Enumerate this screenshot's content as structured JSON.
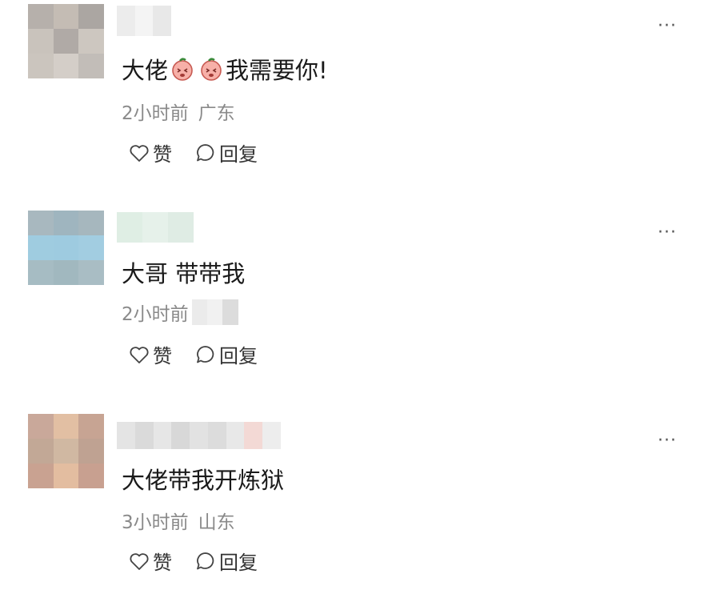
{
  "comments": [
    {
      "text_before": "大佬",
      "text_after": "我需要你!",
      "emoji_count": 2,
      "time": "2小时前",
      "location": "广东",
      "like_label": "赞",
      "reply_label": "回复",
      "avatar_colors": [
        "#b6b0ab",
        "#c4bcb4",
        "#aba6a2",
        "#c9c3bc",
        "#b0aaa6",
        "#cdc7c0",
        "#cbc5be",
        "#d4cec8",
        "#c2bdb8"
      ],
      "username_colors": [
        "#ececec",
        "#f4f4f4",
        "#e8e8e8"
      ]
    },
    {
      "text": "大哥 带带我",
      "time": "2小时前",
      "like_label": "赞",
      "reply_label": "回复",
      "avatar_colors": [
        "#a8b8bf",
        "#9fb5bf",
        "#a6b7be",
        "#9fcce0",
        "#9ecbe0",
        "#a2cde1",
        "#a6bcc3",
        "#a1b8bf",
        "#a9bdc4"
      ],
      "username_colors": [
        "#dfeee4",
        "#e6f1ea",
        "#dfece4"
      ],
      "location_blur_colors": [
        "#ebebeb",
        "#f1f1f1",
        "#dcdcdc"
      ]
    },
    {
      "text": "大佬带我开炼狱",
      "time": "3小时前",
      "location": "山东",
      "like_label": "赞",
      "reply_label": "回复",
      "avatar_colors": [
        "#c9a89a",
        "#e2bfa3",
        "#c7a493",
        "#c2a896",
        "#d0b8a2",
        "#bfa292",
        "#c9a291",
        "#e3bda0",
        "#c8a090"
      ],
      "username_colors": [
        "#e4e4e4",
        "#dadada",
        "#e6e6e6",
        "#d8d8d8",
        "#e2e2e2",
        "#dcdcdc",
        "#e8e8e8",
        "#f3d9d5",
        "#ededed"
      ]
    }
  ],
  "icons": {
    "more": "more-horizontal-icon",
    "like": "heart-icon",
    "reply": "comment-bubble-icon"
  }
}
